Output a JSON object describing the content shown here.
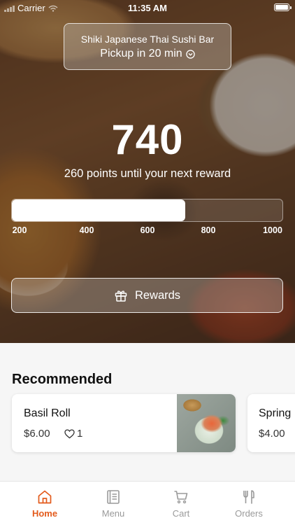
{
  "status_bar": {
    "carrier": "Carrier",
    "time": "11:35 AM"
  },
  "store": {
    "name": "Shiki Japanese Thai Sushi Bar",
    "pickup": "Pickup in 20 min"
  },
  "rewards": {
    "points": "740",
    "until_text": "260 points until your next reward",
    "progress_fraction": 0.64,
    "ticks": [
      "200",
      "400",
      "600",
      "800",
      "1000"
    ],
    "button_label": "Rewards"
  },
  "recommended": {
    "title": "Recommended",
    "items": [
      {
        "name": "Basil Roll",
        "price": "$6.00",
        "likes": "1"
      },
      {
        "name": "Spring",
        "price": "$4.00"
      }
    ]
  },
  "tabs": [
    {
      "label": "Home",
      "icon": "home-icon"
    },
    {
      "label": "Menu",
      "icon": "menu-icon"
    },
    {
      "label": "Cart",
      "icon": "cart-icon"
    },
    {
      "label": "Orders",
      "icon": "orders-icon"
    }
  ],
  "colors": {
    "accent": "#e35b1c"
  }
}
